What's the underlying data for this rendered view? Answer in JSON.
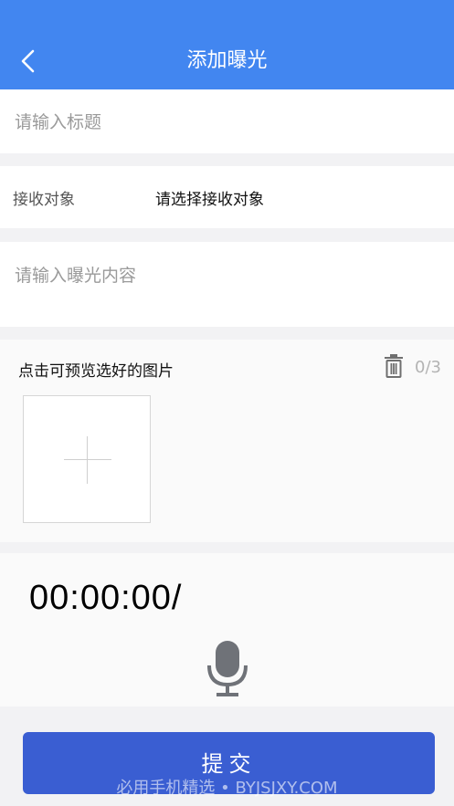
{
  "header": {
    "title": "添加曝光",
    "back_icon": "chevron-left-icon",
    "bg_color": "#4286f0"
  },
  "form": {
    "title_placeholder": "请输入标题",
    "receiver_label": "接收对象",
    "receiver_value": "请选择接收对象",
    "content_placeholder": "请输入曝光内容"
  },
  "images": {
    "hint": "点击可预览选好的图片",
    "count": "0/3",
    "delete_icon": "trash-icon",
    "add_icon": "plus-icon"
  },
  "audio": {
    "timer": "00:00:00/",
    "mic_icon": "microphone-icon"
  },
  "submit": {
    "label": "提交",
    "bg_color": "#3a5ed2"
  },
  "watermark": "必用手机精选 • BYJSJXY.COM"
}
